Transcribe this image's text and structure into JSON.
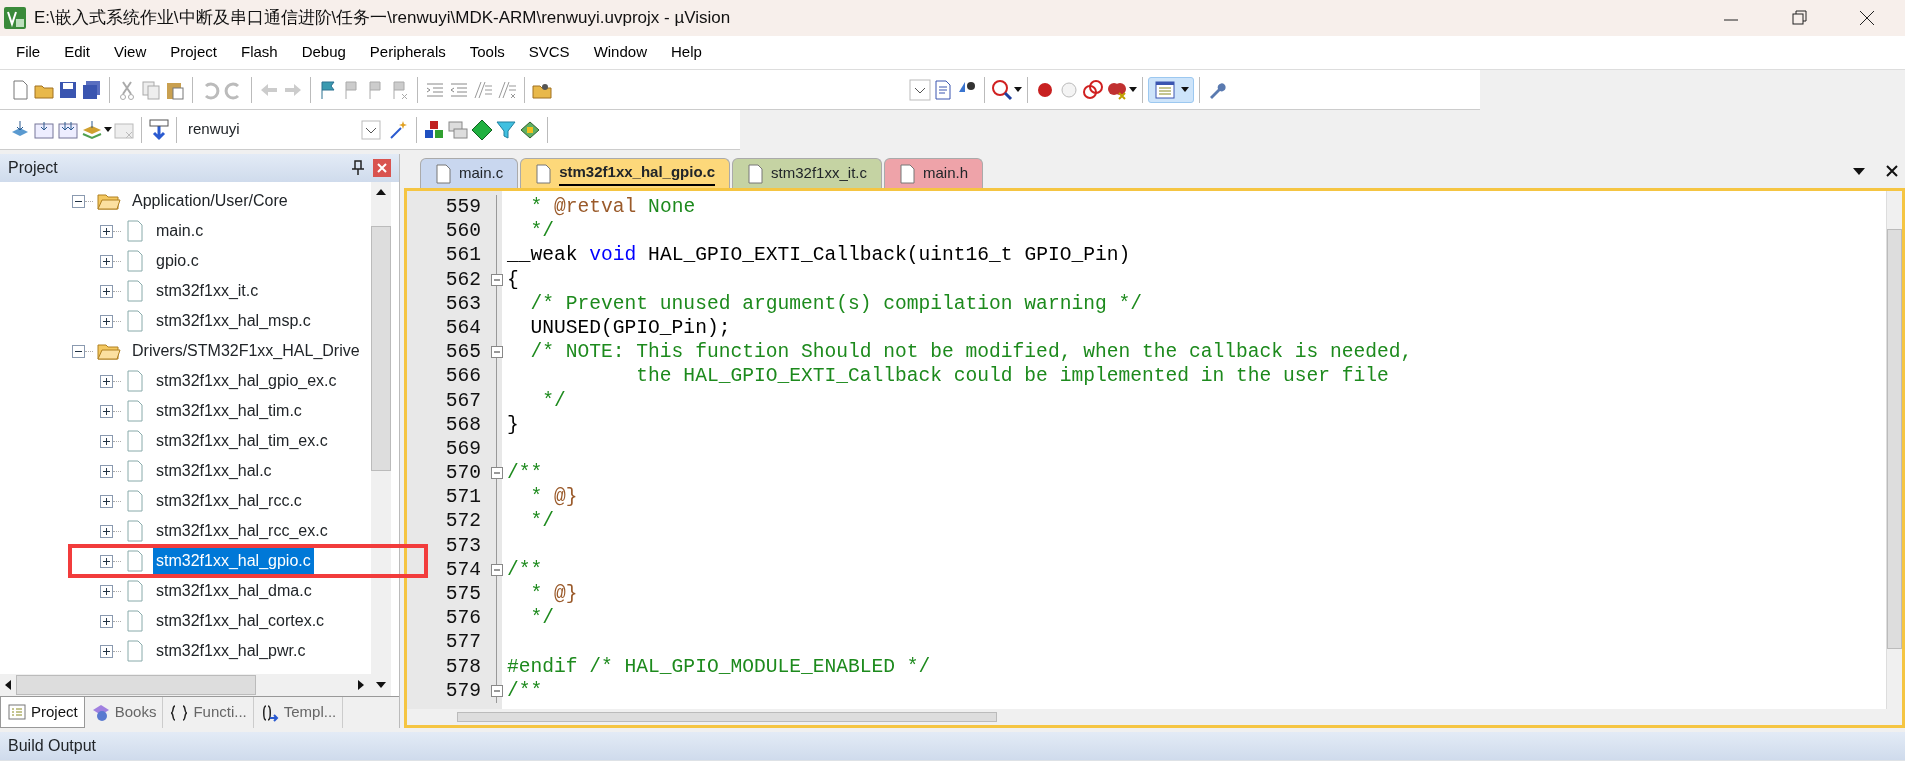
{
  "window": {
    "title": "E:\\嵌入式系统作业\\中断及串口通信进阶\\任务一\\renwuyi\\MDK-ARM\\renwuyi.uvprojx - µVision"
  },
  "menu": [
    "File",
    "Edit",
    "View",
    "Project",
    "Flash",
    "Debug",
    "Peripherals",
    "Tools",
    "SVCS",
    "Window",
    "Help"
  ],
  "toolbar": {
    "target": "renwuyi"
  },
  "project_panel": {
    "title": "Project",
    "tree": [
      {
        "label": "Application/User/Core",
        "kind": "folder",
        "expanded": true,
        "selected": false,
        "children": [
          {
            "label": "main.c",
            "kind": "file",
            "expanded": false,
            "selected": false
          },
          {
            "label": "gpio.c",
            "kind": "file",
            "expanded": false,
            "selected": false
          },
          {
            "label": "stm32f1xx_it.c",
            "kind": "file",
            "expanded": false,
            "selected": false
          },
          {
            "label": "stm32f1xx_hal_msp.c",
            "kind": "file",
            "expanded": false,
            "selected": false
          }
        ]
      },
      {
        "label": "Drivers/STM32F1xx_HAL_Drive",
        "kind": "folder",
        "expanded": true,
        "selected": false,
        "children": [
          {
            "label": "stm32f1xx_hal_gpio_ex.c",
            "kind": "file",
            "expanded": false,
            "selected": false
          },
          {
            "label": "stm32f1xx_hal_tim.c",
            "kind": "file",
            "expanded": false,
            "selected": false
          },
          {
            "label": "stm32f1xx_hal_tim_ex.c",
            "kind": "file",
            "expanded": false,
            "selected": false
          },
          {
            "label": "stm32f1xx_hal.c",
            "kind": "file",
            "expanded": false,
            "selected": false
          },
          {
            "label": "stm32f1xx_hal_rcc.c",
            "kind": "file",
            "expanded": false,
            "selected": false
          },
          {
            "label": "stm32f1xx_hal_rcc_ex.c",
            "kind": "file",
            "expanded": false,
            "selected": false
          },
          {
            "label": "stm32f1xx_hal_gpio.c",
            "kind": "file",
            "expanded": false,
            "selected": true
          },
          {
            "label": "stm32f1xx_hal_dma.c",
            "kind": "file",
            "expanded": false,
            "selected": false
          },
          {
            "label": "stm32f1xx_hal_cortex.c",
            "kind": "file",
            "expanded": false,
            "selected": false
          },
          {
            "label": "stm32f1xx_hal_pwr.c",
            "kind": "file",
            "expanded": false,
            "selected": false
          }
        ]
      }
    ],
    "tabs": [
      {
        "label": "Project",
        "kind": "project",
        "selected": true
      },
      {
        "label": "Books",
        "kind": "books",
        "selected": false
      },
      {
        "label": "Functi...",
        "kind": "functions",
        "selected": false
      },
      {
        "label": "Templ...",
        "kind": "templates",
        "selected": false
      }
    ]
  },
  "editor": {
    "tabs": [
      {
        "label": "main.c",
        "color": "#c9d7ef",
        "selected": false
      },
      {
        "label": "stm32f1xx_hal_gpio.c",
        "color": "#fdd87a",
        "selected": true
      },
      {
        "label": "stm32f1xx_it.c",
        "color": "#c5d3a3",
        "selected": false
      },
      {
        "label": "main.h",
        "color": "#eea3a9",
        "selected": false
      }
    ],
    "lines": [
      {
        "number": "559",
        "foldable": false,
        "segments": [
          {
            "kind": "comment",
            "text": "  * "
          },
          {
            "kind": "doctag",
            "text": "@retval"
          },
          {
            "kind": "comment",
            "text": " None"
          }
        ]
      },
      {
        "number": "560",
        "foldable": false,
        "segments": [
          {
            "kind": "comment",
            "text": "  */"
          }
        ]
      },
      {
        "number": "561",
        "foldable": false,
        "segments": [
          {
            "kind": "plain",
            "text": "__weak "
          },
          {
            "kind": "keyword",
            "text": "void"
          },
          {
            "kind": "plain",
            "text": " HAL_GPIO_EXTI_Callback(uint16_t GPIO_Pin)"
          }
        ]
      },
      {
        "number": "562",
        "foldable": true,
        "segments": [
          {
            "kind": "plain",
            "text": "{"
          }
        ]
      },
      {
        "number": "563",
        "foldable": false,
        "segments": [
          {
            "kind": "comment",
            "text": "  /* Prevent unused argument(s) compilation warning */"
          }
        ]
      },
      {
        "number": "564",
        "foldable": false,
        "segments": [
          {
            "kind": "plain",
            "text": "  UNUSED(GPIO_Pin);"
          }
        ]
      },
      {
        "number": "565",
        "foldable": true,
        "segments": [
          {
            "kind": "comment",
            "text": "  /* NOTE: This function Should not be modified, when the callback is needed,"
          }
        ]
      },
      {
        "number": "566",
        "foldable": false,
        "segments": [
          {
            "kind": "comment",
            "text": "           the HAL_GPIO_EXTI_Callback could be implemented in the user file"
          }
        ]
      },
      {
        "number": "567",
        "foldable": false,
        "segments": [
          {
            "kind": "comment",
            "text": "   */"
          }
        ]
      },
      {
        "number": "568",
        "foldable": false,
        "segments": [
          {
            "kind": "plain",
            "text": "}"
          }
        ]
      },
      {
        "number": "569",
        "foldable": false
      },
      {
        "number": "570",
        "foldable": true,
        "segments": [
          {
            "kind": "comment",
            "text": "/**"
          }
        ]
      },
      {
        "number": "571",
        "foldable": false,
        "segments": [
          {
            "kind": "comment",
            "text": "  * "
          },
          {
            "kind": "doctag",
            "text": "@}"
          }
        ]
      },
      {
        "number": "572",
        "foldable": false,
        "segments": [
          {
            "kind": "comment",
            "text": "  */"
          }
        ]
      },
      {
        "number": "573",
        "foldable": false
      },
      {
        "number": "574",
        "foldable": true,
        "segments": [
          {
            "kind": "comment",
            "text": "/**"
          }
        ]
      },
      {
        "number": "575",
        "foldable": false,
        "segments": [
          {
            "kind": "comment",
            "text": "  * "
          },
          {
            "kind": "doctag",
            "text": "@}"
          }
        ]
      },
      {
        "number": "576",
        "foldable": false,
        "segments": [
          {
            "kind": "comment",
            "text": "  */"
          }
        ]
      },
      {
        "number": "577",
        "foldable": false
      },
      {
        "number": "578",
        "foldable": false,
        "segments": [
          {
            "kind": "comment",
            "text": "#endif /* HAL_GPIO_MODULE_ENABLED */"
          }
        ]
      },
      {
        "number": "579",
        "foldable": true,
        "segments": [
          {
            "kind": "comment",
            "text": "/**"
          }
        ]
      }
    ]
  },
  "build_output": {
    "title": "Build Output"
  }
}
